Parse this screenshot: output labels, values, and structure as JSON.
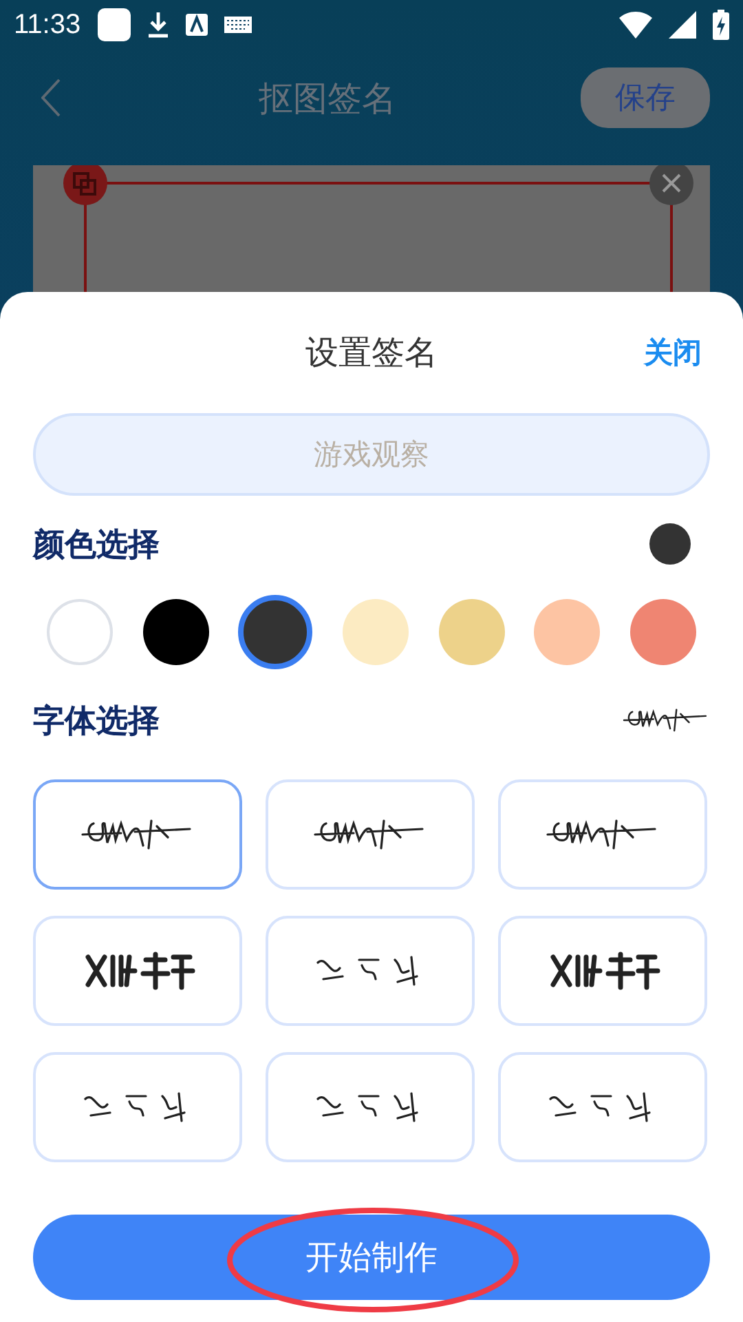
{
  "status_bar": {
    "time": "11:33"
  },
  "header": {
    "title": "抠图签名",
    "save_label": "保存"
  },
  "sheet": {
    "title": "设置签名",
    "close_label": "关闭"
  },
  "name_field": {
    "value": "游戏观察"
  },
  "color_section": {
    "title": "颜色选择",
    "preview": {
      "color": "#333333"
    },
    "swatches": [
      {
        "color": "#ffffff",
        "outlined": true,
        "selected": false
      },
      {
        "color": "#000000",
        "outlined": false,
        "selected": false
      },
      {
        "color": "#333333",
        "outlined": false,
        "selected": true
      },
      {
        "color": "#fcebc2",
        "outlined": false,
        "selected": false
      },
      {
        "color": "#edd28a",
        "outlined": false,
        "selected": false
      },
      {
        "color": "#fdc4a3",
        "outlined": false,
        "selected": false
      },
      {
        "color": "#ef8572",
        "outlined": false,
        "selected": false
      }
    ]
  },
  "font_section": {
    "title": "字体选择",
    "fonts": [
      {
        "kind": "scrawl",
        "selected": true
      },
      {
        "kind": "scrawl",
        "selected": false
      },
      {
        "kind": "scrawl",
        "selected": false
      },
      {
        "kind": "print",
        "selected": false
      },
      {
        "kind": "brush",
        "selected": false
      },
      {
        "kind": "print",
        "selected": false
      },
      {
        "kind": "brush",
        "selected": false
      },
      {
        "kind": "brush",
        "selected": false
      },
      {
        "kind": "brush",
        "selected": false
      }
    ]
  },
  "start_button": {
    "label": "开始制作"
  }
}
